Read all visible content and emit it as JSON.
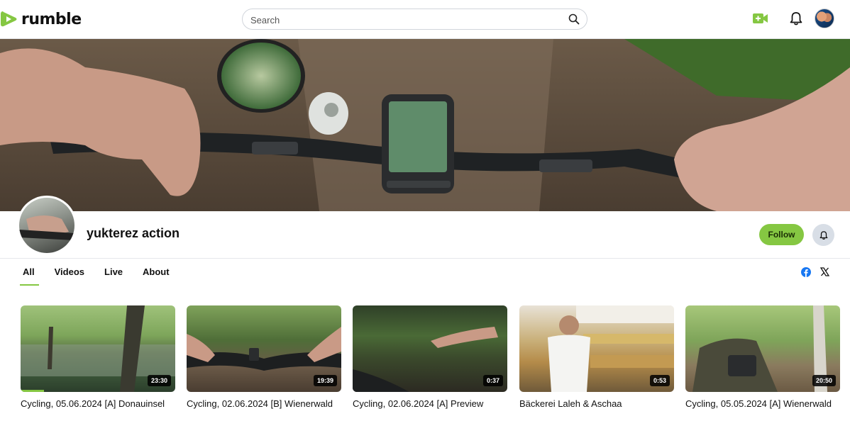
{
  "header": {
    "logo_text": "rumble",
    "search_placeholder": "Search"
  },
  "channel": {
    "name": "yukterez action",
    "follow_label": "Follow"
  },
  "tabs": [
    {
      "label": "All",
      "active": true
    },
    {
      "label": "Videos",
      "active": false
    },
    {
      "label": "Live",
      "active": false
    },
    {
      "label": "About",
      "active": false
    }
  ],
  "videos": [
    {
      "title": "Cycling, 05.06.2024 [A] Donauinsel",
      "duration": "23:30",
      "watched_fraction": 0.15
    },
    {
      "title": "Cycling, 02.06.2024 [B] Wienerwald",
      "duration": "19:39"
    },
    {
      "title": "Cycling, 02.06.2024 [A] Preview",
      "duration": "0:37"
    },
    {
      "title": "Bäckerei Laleh & Aschaa",
      "duration": "0:53"
    },
    {
      "title": "Cycling, 05.05.2024 [A] Wienerwald",
      "duration": "20:50"
    }
  ],
  "colors": {
    "brand": "#85c742",
    "divider": "#e5e7eb"
  },
  "icons": [
    "rumble-logo-icon",
    "search-icon",
    "upload-video-icon",
    "bell-icon",
    "facebook-icon",
    "x-icon"
  ]
}
